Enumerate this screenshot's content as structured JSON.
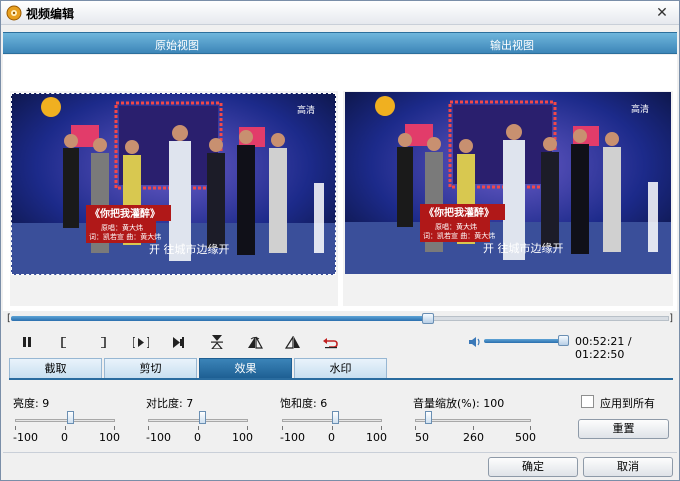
{
  "window": {
    "title": "视频编辑"
  },
  "views": {
    "original_title": "原始视图",
    "output_title": "输出视图"
  },
  "video": {
    "channel_badge": "高清",
    "caption_song": "《你把我灌醉》",
    "caption_credits_line1": "原唱：黄大炜",
    "caption_credits_line2": "词：凯若宣  曲：黄大炜",
    "caption_lyric": "开 往城市边缘开"
  },
  "playback": {
    "position_fraction": 0.633,
    "volume_fraction": 0.95,
    "time_display": "00:52:21 / 01:22:50",
    "buttons": {
      "pause": "pause-icon",
      "mark_in": "mark-in-icon",
      "mark_out": "mark-out-icon",
      "next_frame": "next-frame-icon",
      "skip_end": "skip-end-icon",
      "flip_vertical": "flip-vertical-icon",
      "flip_horizontal": "flip-horizontal-icon",
      "rotate": "rotate-icon",
      "undo": "undo-icon"
    }
  },
  "tabs": [
    {
      "label": "截取",
      "active": false
    },
    {
      "label": "剪切",
      "active": false
    },
    {
      "label": "效果",
      "active": true
    },
    {
      "label": "水印",
      "active": false
    }
  ],
  "effects": {
    "brightness": {
      "label": "亮度:  9",
      "value": 9,
      "min": "-100",
      "mid": "0",
      "max": "100"
    },
    "contrast": {
      "label": "对比度:  7",
      "value": 7,
      "min": "-100",
      "mid": "0",
      "max": "100"
    },
    "saturation": {
      "label": "饱和度:  6",
      "value": 6,
      "min": "-100",
      "mid": "0",
      "max": "100"
    },
    "volume_scale": {
      "label": "音量缩放(%):  100",
      "value": 100,
      "min": "50",
      "mid": "260",
      "max": "500"
    },
    "apply_all_label": "应用到所有",
    "apply_all_checked": false,
    "reset_label": "重置"
  },
  "footer": {
    "ok_label": "确定",
    "cancel_label": "取消"
  },
  "colors": {
    "accent": "#2a6c9f",
    "header_blue": "#3d86b8"
  }
}
